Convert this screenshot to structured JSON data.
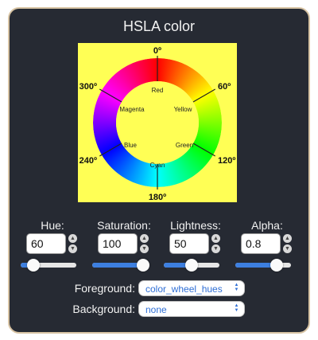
{
  "title": "HSLA color",
  "swatch_color": "#ffff55",
  "wheel": {
    "degree_labels": [
      "0º",
      "60º",
      "120º",
      "180º",
      "240º",
      "300º"
    ],
    "hue_names": [
      "Red",
      "Yellow",
      "Green",
      "Cyan",
      "Blue",
      "Magenta"
    ]
  },
  "controls": [
    {
      "label": "Hue:",
      "value": "60",
      "fraction": 0.167
    },
    {
      "label": "Saturation:",
      "value": "100",
      "fraction": 1.0
    },
    {
      "label": "Lightness:",
      "value": "50",
      "fraction": 0.5
    },
    {
      "label": "Alpha:",
      "value": "0.8",
      "fraction": 0.8
    }
  ],
  "slider_color": "#3d7fe0",
  "foreground": {
    "label": "Foreground:",
    "value": "color_wheel_hues"
  },
  "background": {
    "label": "Background:",
    "value": "none"
  }
}
